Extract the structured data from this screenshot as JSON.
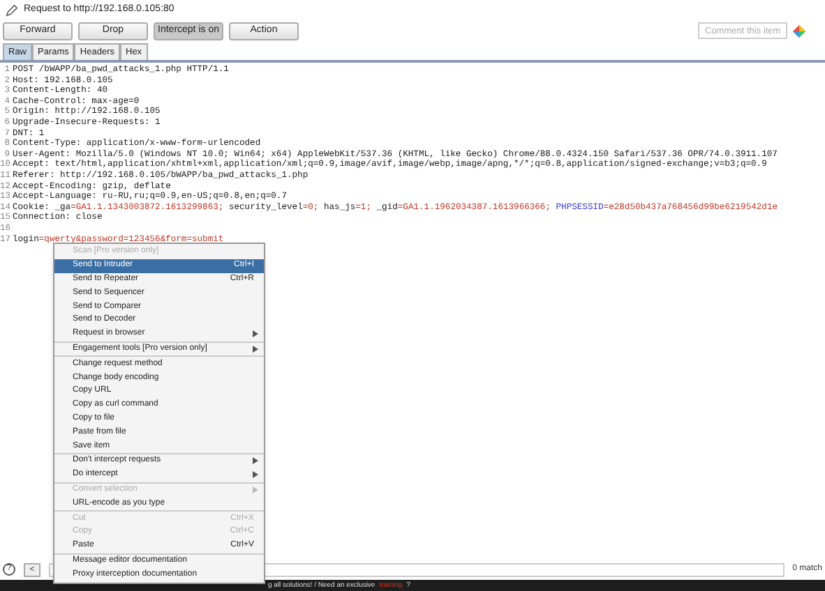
{
  "title": "Request to http://192.168.0.105:80",
  "buttons": [
    {
      "label": "Forward",
      "selected": false
    },
    {
      "label": "Drop",
      "selected": false
    },
    {
      "label": "Intercept is on",
      "selected": true
    },
    {
      "label": "Action",
      "selected": false
    }
  ],
  "comment_field": {
    "placeholder": "Comment this item"
  },
  "tabs": [
    {
      "label": "Raw",
      "selected": true
    },
    {
      "label": "Params",
      "selected": false
    },
    {
      "label": "Headers",
      "selected": false
    },
    {
      "label": "Hex",
      "selected": false
    }
  ],
  "lines": [
    {
      "number": "1",
      "parts": [
        {
          "kind": "plain",
          "text": "POST /bWAPP/ba_pwd_attacks_1.php HTTP/1.1"
        }
      ]
    },
    {
      "number": "2",
      "parts": [
        {
          "kind": "plain",
          "text": "Host: 192.168.0.105"
        }
      ]
    },
    {
      "number": "3",
      "parts": [
        {
          "kind": "plain",
          "text": "Content-Length: 40"
        }
      ]
    },
    {
      "number": "4",
      "parts": [
        {
          "kind": "plain",
          "text": "Cache-Control: max-age=0"
        }
      ]
    },
    {
      "number": "5",
      "parts": [
        {
          "kind": "plain",
          "text": "Origin: http://192.168.0.105"
        }
      ]
    },
    {
      "number": "6",
      "parts": [
        {
          "kind": "plain",
          "text": "Upgrade-Insecure-Requests: 1"
        }
      ]
    },
    {
      "number": "7",
      "parts": [
        {
          "kind": "plain",
          "text": "DNT: 1"
        }
      ]
    },
    {
      "number": "8",
      "parts": [
        {
          "kind": "plain",
          "text": "Content-Type: application/x-www-form-urlencoded"
        }
      ]
    },
    {
      "number": "9",
      "parts": [
        {
          "kind": "plain",
          "text": "User-Agent: Mozilla/5.0 (Windows NT 10.0; Win64; x64) AppleWebKit/537.36 (KHTML, like Gecko) Chrome/88.0.4324.150 Safari/537.36 OPR/74.0.3911.107"
        }
      ]
    },
    {
      "number": "10",
      "parts": [
        {
          "kind": "plain",
          "text": "Accept: text/html,application/xhtml+xml,application/xml;q=0.9,image/avif,image/webp,image/apng,*/*;q=0.8,application/signed-exchange;v=b3;q=0.9"
        }
      ]
    },
    {
      "number": "11",
      "parts": [
        {
          "kind": "plain",
          "text": "Referer: http://192.168.0.105/bWAPP/ba_pwd_attacks_1.php"
        }
      ]
    },
    {
      "number": "12",
      "parts": [
        {
          "kind": "plain",
          "text": "Accept-Encoding: gzip, deflate"
        }
      ]
    },
    {
      "number": "13",
      "parts": [
        {
          "kind": "plain",
          "text": "Accept-Language: ru-RU,ru;q=0.9,en-US;q=0.8,en;q=0.7"
        }
      ]
    },
    {
      "number": "14",
      "parts": [
        {
          "kind": "plain",
          "text": "Cookie: _ga"
        },
        {
          "kind": "value",
          "text": "=GA1.1.1343003872.1613299863;"
        },
        {
          "kind": "plain",
          "text": " security_level"
        },
        {
          "kind": "value",
          "text": "=0;"
        },
        {
          "kind": "plain",
          "text": " has_js"
        },
        {
          "kind": "value",
          "text": "=1;"
        },
        {
          "kind": "plain",
          "text": " _gid"
        },
        {
          "kind": "value",
          "text": "=GA1.1.1962034387.1613966366;"
        },
        {
          "kind": "key",
          "text": " PHPSESSID"
        },
        {
          "kind": "value",
          "text": "=e28d50b437a768456d99be6219542d1e"
        }
      ]
    },
    {
      "number": "15",
      "parts": [
        {
          "kind": "plain",
          "text": "Connection: close"
        }
      ]
    },
    {
      "number": "16"
    },
    {
      "number": "17",
      "parts": [
        {
          "kind": "plain",
          "text": "login"
        },
        {
          "kind": "value",
          "text": "=qwerty&password=123456&form=submit"
        }
      ]
    }
  ],
  "context_menu": [
    [
      {
        "label": "Scan [Pro version only]",
        "disabled": true,
        "selected": false
      },
      {
        "label": "Send to Intruder",
        "shortcut": "Ctrl+I",
        "disabled": false,
        "selected": true
      },
      {
        "label": "Send to Repeater",
        "shortcut": "Ctrl+R",
        "disabled": false,
        "selected": false
      },
      {
        "label": "Send to Sequencer",
        "disabled": false,
        "selected": false
      },
      {
        "label": "Send to Comparer",
        "disabled": false,
        "selected": false
      },
      {
        "label": "Send to Decoder",
        "disabled": false,
        "selected": false
      },
      {
        "label": "Request in browser",
        "submenu": true,
        "disabled": false,
        "selected": false
      }
    ],
    [
      {
        "label": "Engagement tools [Pro version only]",
        "submenu": true,
        "disabled": false,
        "selected": false
      }
    ],
    [
      {
        "label": "Change request method",
        "disabled": false,
        "selected": false
      },
      {
        "label": "Change body encoding",
        "disabled": false,
        "selected": false
      },
      {
        "label": "Copy URL",
        "disabled": false,
        "selected": false
      },
      {
        "label": "Copy as curl command",
        "disabled": false,
        "selected": false
      },
      {
        "label": "Copy to file",
        "disabled": false,
        "selected": false
      },
      {
        "label": "Paste from file",
        "disabled": false,
        "selected": false
      },
      {
        "label": "Save item",
        "disabled": false,
        "selected": false
      }
    ],
    [
      {
        "label": "Don't intercept requests",
        "submenu": true,
        "disabled": false,
        "selected": false
      },
      {
        "label": "Do intercept",
        "submenu": true,
        "disabled": false,
        "selected": false
      }
    ],
    [
      {
        "label": "Convert selection",
        "submenu": true,
        "disabled": true,
        "selected": false
      },
      {
        "label": "URL-encode as you type",
        "disabled": false,
        "selected": false
      }
    ],
    [
      {
        "label": "Cut",
        "shortcut": "Ctrl+X",
        "disabled": true,
        "selected": false
      },
      {
        "label": "Copy",
        "shortcut": "Ctrl+C",
        "disabled": true,
        "selected": false
      },
      {
        "label": "Paste",
        "shortcut": "Ctrl+V",
        "disabled": false,
        "selected": false
      }
    ],
    [
      {
        "label": "Message editor documentation",
        "disabled": false,
        "selected": false
      },
      {
        "label": "Proxy interception documentation",
        "disabled": false,
        "selected": false
      }
    ]
  ],
  "search_bar": {
    "help": "?",
    "prev": "<",
    "matches": "0 match"
  },
  "banner": {
    "text": "g all solutions! / Need an exclusive",
    "link": "training",
    "end": "?"
  }
}
